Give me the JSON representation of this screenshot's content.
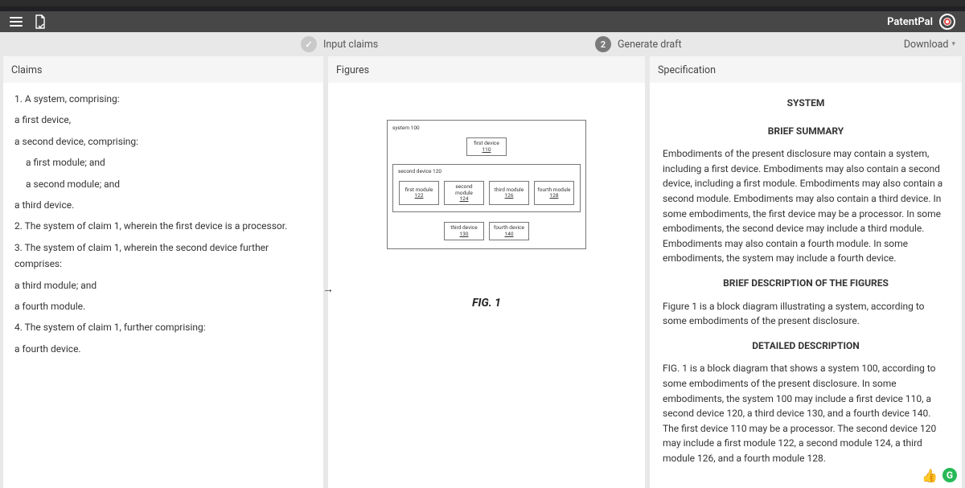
{
  "browser": {
    "url_fragment": "draftpatentpal.com"
  },
  "header": {
    "brand": "PatentPal"
  },
  "steps": {
    "s1": {
      "label": "Input claims",
      "check": "✓"
    },
    "s2": {
      "num": "2",
      "label": "Generate draft"
    },
    "download": "Download"
  },
  "columns": {
    "claims": {
      "title": "Claims",
      "lines": [
        "1. A system, comprising:",
        "a first device,",
        "a second device, comprising:",
        "a first module; and",
        "a second module; and",
        "a third device.",
        "2. The system of claim 1, wherein the first device is a processor.",
        "3. The system of claim 1, wherein the second device further comprises:",
        "a third module; and",
        "a fourth module.",
        "4. The system of claim 1, further comprising:",
        "a fourth device."
      ],
      "indents": [
        0,
        0,
        0,
        1,
        1,
        0,
        0,
        0,
        0,
        0,
        0,
        0
      ]
    },
    "figures": {
      "title": "Figures",
      "diagram": {
        "system_label": "system 100",
        "first_device": {
          "name": "first device",
          "num": "110"
        },
        "second_device_label": "second device 120",
        "modules": [
          {
            "name": "first module",
            "num": "122"
          },
          {
            "name": "second module",
            "num": "124"
          },
          {
            "name": "third module",
            "num": "126"
          },
          {
            "name": "fourth module",
            "num": "128"
          }
        ],
        "free": [
          {
            "name": "third device",
            "num": "130"
          },
          {
            "name": "fourth device",
            "num": "140"
          }
        ]
      },
      "caption": "FIG. 1"
    },
    "spec": {
      "title": "Specification",
      "doc_title": "SYSTEM",
      "h_summary": "BRIEF SUMMARY",
      "p_summary": "Embodiments of the present disclosure may contain a system, including a first device. Embodiments may also contain a second device, including a first module. Embodiments may also contain a second module. Embodiments may also contain a third device. In some embodiments, the first device may be a processor. In some embodiments, the second device may include a third module. Embodiments may also contain a fourth module. In some embodiments, the system may include a fourth device.",
      "h_figdesc": "BRIEF DESCRIPTION OF THE FIGURES",
      "p_figdesc": "Figure 1 is a block diagram illustrating a system, according to some embodiments of the present disclosure.",
      "h_detail": "DETAILED DESCRIPTION",
      "p_detail": "FIG. 1 is a block diagram that shows a system 100, according to some embodiments of the present disclosure. In some embodiments, the system 100 may include a first device 110, a second device 120, a third device 130, and a fourth device 140. The first device 110 may be a processor. The second device 120 may include a first module 122, a second module 124, a third module 126, and a fourth module 128."
    }
  }
}
